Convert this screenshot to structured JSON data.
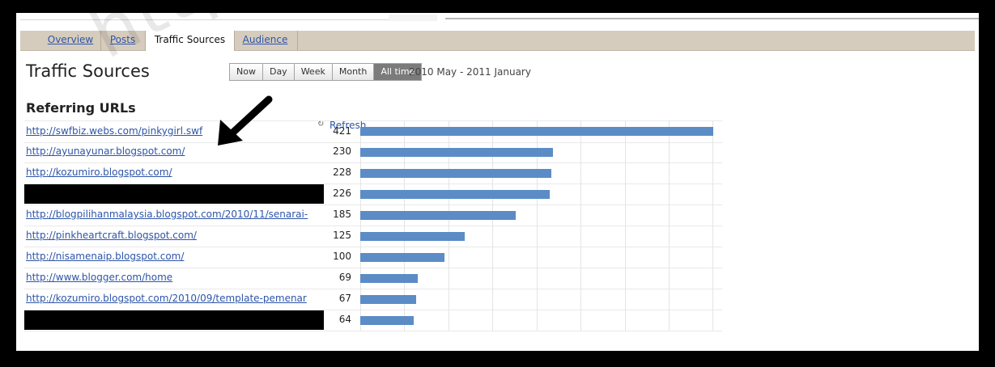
{
  "tabs": [
    "Overview",
    "Posts",
    "Traffic Sources",
    "Audience"
  ],
  "page": {
    "title": "Traffic Sources",
    "refresh_label": "Refresh",
    "time_buttons": [
      "Now",
      "Day",
      "Week",
      "Month",
      "All time"
    ],
    "date_range": "2010 May - 2011 January"
  },
  "referrers": {
    "heading": "Referring URLs",
    "rows": [
      {
        "url": "http://swfbiz.webs.com/pinkygirl.swf",
        "count": "421",
        "value": 421
      },
      {
        "url": "http://ayunayunar.blogspot.com/",
        "count": "230",
        "value": 230
      },
      {
        "url": "http://kozumiro.blogspot.com/",
        "count": "228",
        "value": 228
      },
      {
        "url": "",
        "count": "226",
        "value": 226
      },
      {
        "url": "http://blogpilihanmalaysia.blogspot.com/2010/11/senarai-",
        "count": "185",
        "value": 185
      },
      {
        "url": "http://pinkheartcraft.blogspot.com/",
        "count": "125",
        "value": 125
      },
      {
        "url": "http://nisamenaip.blogspot.com/",
        "count": "100",
        "value": 100
      },
      {
        "url": "http://www.blogger.com/home",
        "count": "69",
        "value": 69
      },
      {
        "url": "http://kozumiro.blogspot.com/2010/09/template-pemenar",
        "count": "67",
        "value": 67
      },
      {
        "url": "",
        "count": "64",
        "value": 64
      }
    ],
    "max_value": 421
  },
  "watermark": "http://pinkygirltalk.blogspot.com/",
  "colors": {
    "bar": "#5b8cc6",
    "tab_bar": "#d6ccbd",
    "link": "#2d55a8"
  }
}
